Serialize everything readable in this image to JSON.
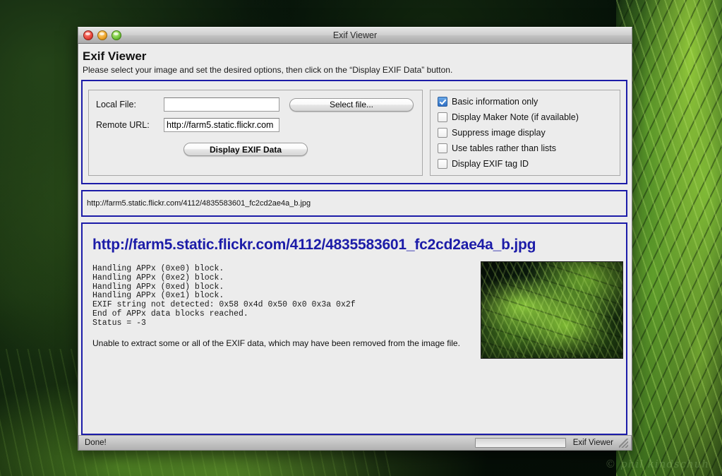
{
  "desktop": {
    "watermark": "© phil kindschuh"
  },
  "window": {
    "title": "Exif Viewer",
    "traffic_lights": {
      "close": "close-button",
      "minimize": "minimize-button",
      "zoom": "zoom-button"
    }
  },
  "page": {
    "heading": "Exif Viewer",
    "subtitle": "Please select your image and set the desired options, then click on the “Display EXIF Data” button."
  },
  "form": {
    "local_file_label": "Local File:",
    "local_file_value": "",
    "local_file_placeholder": "",
    "remote_url_label": "Remote URL:",
    "remote_url_value": "http://farm5.static.flickr.com",
    "remote_url_placeholder": "",
    "select_file_button": "Select file...",
    "display_exif_button": "Display EXIF Data"
  },
  "options": [
    {
      "label": "Basic information only",
      "checked": true
    },
    {
      "label": "Display Maker Note (if available)",
      "checked": false
    },
    {
      "label": "Suppress image display",
      "checked": false
    },
    {
      "label": "Use tables rather than lists",
      "checked": false
    },
    {
      "label": "Display EXIF tag ID",
      "checked": false
    }
  ],
  "url_bar": {
    "text": "http://farm5.static.flickr.com/4112/4835583601_fc2cd2ae4a_b.jpg"
  },
  "results": {
    "heading": "http://farm5.static.flickr.com/4112/4835583601_fc2cd2ae4a_b.jpg",
    "console": "Handling APPx (0xe0) block.\nHandling APPx (0xe2) block.\nHandling APPx (0xed) block.\nHandling APPx (0xe1) block.\nEXIF string not detected: 0x58 0x4d 0x50 0x0 0x3a 0x2f\nEnd of APPx data blocks reached.\nStatus = -3",
    "note": "Unable to extract some or all of the EXIF data, which may have been removed from the image file.",
    "thumbnail_alt": "fern-photo-thumbnail"
  },
  "statusbar": {
    "status": "Done!",
    "app_name": "Exif Viewer",
    "progress_percent": 0
  },
  "colors": {
    "panel_border": "#1c1ca8",
    "heading_link": "#1c1ca8",
    "checkbox_checked": "#2f6fc4",
    "window_chrome": "#ececec"
  }
}
